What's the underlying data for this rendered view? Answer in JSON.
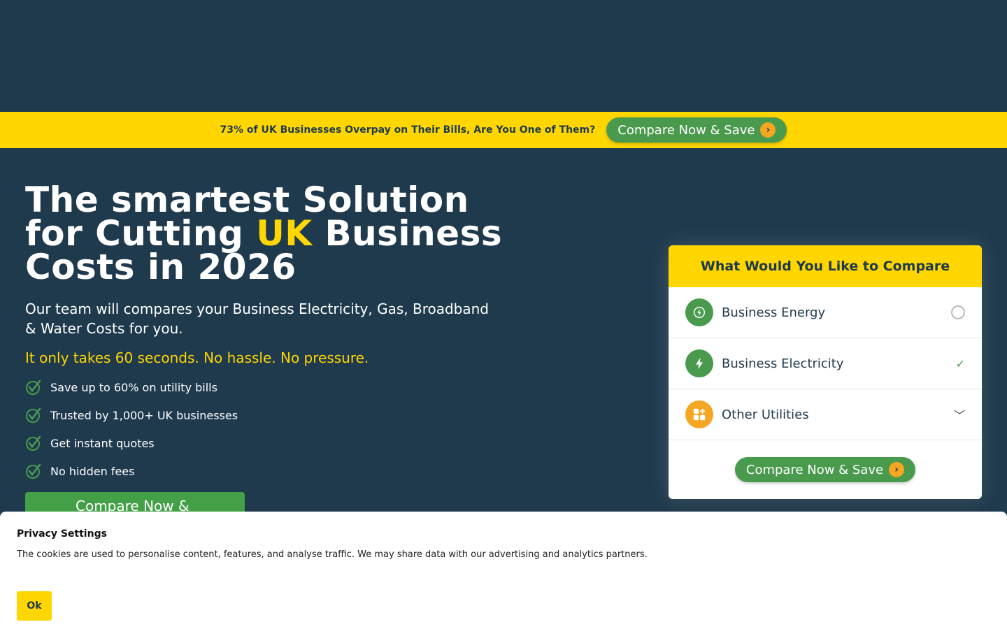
{
  "promo": {
    "text": "73% of UK Businesses Overpay on Their Bills, Are You One of Them?",
    "button_label": "Compare Now & Save"
  },
  "hero": {
    "title_line1": "The smartest Solution",
    "title_line2_pre": "for Cutting ",
    "title_accent": "UK",
    "title_line2_post": " Business",
    "title_line3": "Costs in 2026",
    "subtitle": "Our team will compares your Business Electricity, Gas, Broadband & Water Costs for you.",
    "tagline": "It only takes 60 seconds. No hassle. No pressure.",
    "features": [
      "Save up to 60% on utility bills",
      "Trusted by 1,000+ UK businesses",
      "Get instant quotes",
      "No hidden fees"
    ],
    "cta_label": "Compare Now & Save"
  },
  "compare_card": {
    "title": "What Would You Like to Compare",
    "options": [
      {
        "label": "Business Energy",
        "icon": "energy-icon",
        "state": "unselected"
      },
      {
        "label": "Business Electricity",
        "icon": "lightning-icon",
        "state": "selected"
      },
      {
        "label": "Other Utilities",
        "icon": "apps-icon",
        "state": "expandable"
      }
    ],
    "button_label": "Compare Now & Save"
  },
  "cookie": {
    "title": "Privacy Settings",
    "text": "The cookies are used to personalise content, features, and analyse traffic. We may share data with our advertising and analytics partners.",
    "ok_label": "Ok"
  },
  "colors": {
    "background": "#1f3a4d",
    "accent_yellow": "#ffd600",
    "accent_green": "#4a9a4e",
    "arrow_orange": "#f5a623"
  }
}
